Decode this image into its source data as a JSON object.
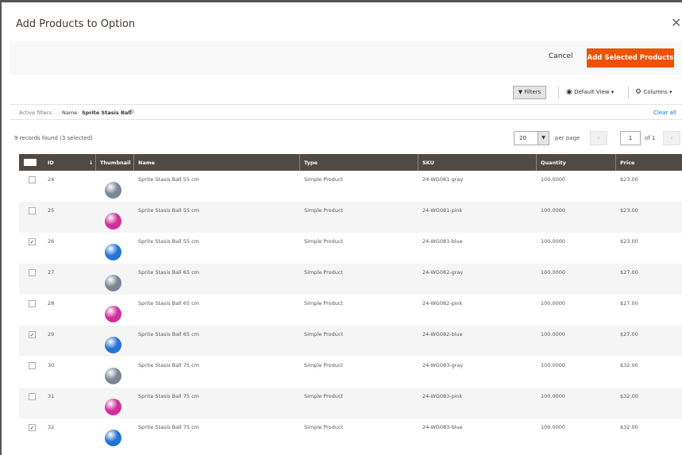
{
  "modal": {
    "title": "Add Products to Option",
    "close_symbol": "✕"
  },
  "actions": {
    "cancel_label": "Cancel",
    "add_label": "Add Selected Products"
  },
  "toolbar": {
    "filters_label": "Filters",
    "view_label": "Default View",
    "columns_label": "Columns"
  },
  "active_filters": {
    "label": "Active filters:",
    "filter_name": "Name:",
    "filter_value": "Sprite Stasis Ball",
    "clear_all": "Clear all"
  },
  "records": {
    "text": "9 records found (3 selected)"
  },
  "pagination": {
    "per_page_value": "20",
    "per_page_label": "per page",
    "page": "1",
    "of_label": "of 1"
  },
  "columns": {
    "id": "ID",
    "thumbnail": "Thumbnail",
    "name": "Name",
    "type": "Type",
    "sku": "SKU",
    "quantity": "Quantity",
    "price": "Price"
  },
  "colors": {
    "gray": "#7a8595",
    "pink": "#d02e9a",
    "blue": "#2474d6",
    "accent": "#eb5202",
    "header": "#514943"
  },
  "rows": [
    {
      "checked": false,
      "id": "24",
      "color": "gray",
      "name": "Sprite Stasis Ball 55 cm",
      "type": "Simple Product",
      "sku": "24-WG081-gray",
      "qty": "100.0000",
      "price": "$23.00"
    },
    {
      "checked": false,
      "id": "25",
      "color": "pink",
      "name": "Sprite Stasis Ball 55 cm",
      "type": "Simple Product",
      "sku": "24-WG081-pink",
      "qty": "100.0000",
      "price": "$23.00"
    },
    {
      "checked": true,
      "id": "26",
      "color": "blue",
      "name": "Sprite Stasis Ball 55 cm",
      "type": "Simple Product",
      "sku": "24-WG081-blue",
      "qty": "100.0000",
      "price": "$23.00"
    },
    {
      "checked": false,
      "id": "27",
      "color": "gray",
      "name": "Sprite Stasis Ball 65 cm",
      "type": "Simple Product",
      "sku": "24-WG082-gray",
      "qty": "100.0000",
      "price": "$27.00"
    },
    {
      "checked": false,
      "id": "28",
      "color": "pink",
      "name": "Sprite Stasis Ball 65 cm",
      "type": "Simple Product",
      "sku": "24-WG082-pink",
      "qty": "100.0000",
      "price": "$27.00"
    },
    {
      "checked": true,
      "id": "29",
      "color": "blue",
      "name": "Sprite Stasis Ball 65 cm",
      "type": "Simple Product",
      "sku": "24-WG082-blue",
      "qty": "100.0000",
      "price": "$27.00"
    },
    {
      "checked": false,
      "id": "30",
      "color": "gray",
      "name": "Sprite Stasis Ball 75 cm",
      "type": "Simple Product",
      "sku": "24-WG083-gray",
      "qty": "100.0000",
      "price": "$32.00"
    },
    {
      "checked": false,
      "id": "31",
      "color": "pink",
      "name": "Sprite Stasis Ball 75 cm",
      "type": "Simple Product",
      "sku": "24-WG083-pink",
      "qty": "100.0000",
      "price": "$32.00"
    },
    {
      "checked": true,
      "id": "32",
      "color": "blue",
      "name": "Sprite Stasis Ball 75 cm",
      "type": "Simple Product",
      "sku": "24-WG083-blue",
      "qty": "100.0000",
      "price": "$32.00"
    }
  ]
}
